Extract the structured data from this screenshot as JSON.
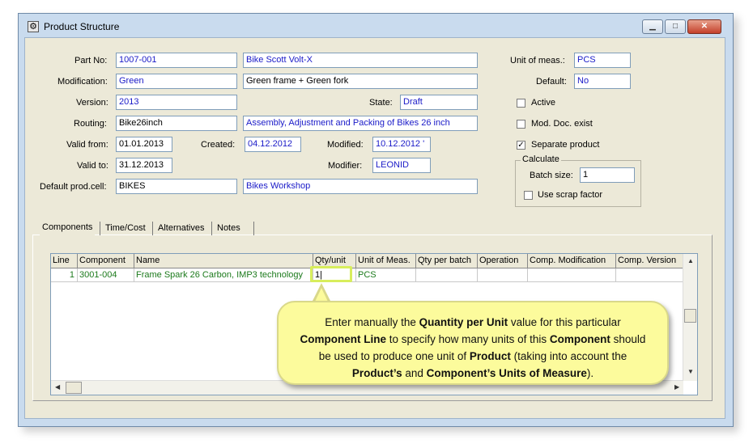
{
  "window": {
    "title": "Product Structure",
    "min_icon": "minimize-icon",
    "max_icon": "maximize-icon",
    "close_icon": "close-icon"
  },
  "form": {
    "part_no_label": "Part No:",
    "part_no": "1007-001",
    "part_name": "Bike Scott Volt-X",
    "modification_label": "Modification:",
    "modification": "Green",
    "modification_desc": "Green frame + Green fork",
    "version_label": "Version:",
    "version": "2013",
    "state_label": "State:",
    "state": "Draft",
    "routing_label": "Routing:",
    "routing": "Bike26inch",
    "routing_desc": "Assembly, Adjustment and Packing of Bikes 26 inch",
    "valid_from_label": "Valid from:",
    "valid_from": "01.01.2013",
    "created_label": "Created:",
    "created": "04.12.2012",
    "modified_label": "Modified:",
    "modified": "10.12.2012 '",
    "valid_to_label": "Valid to:",
    "valid_to": "31.12.2013",
    "modifier_label": "Modifier:",
    "modifier": "LEONID",
    "prod_cell_label": "Default prod.cell:",
    "prod_cell": "BIKES",
    "prod_cell_desc": "Bikes Workshop",
    "uom_label": "Unit of meas.:",
    "uom": "PCS",
    "default_label": "Default:",
    "default": "No",
    "active_label": "Active",
    "mod_doc_label": "Mod. Doc. exist",
    "separate_label": "Separate product",
    "calculate_label": "Calculate",
    "batch_label": "Batch size:",
    "batch": "1",
    "scrap_label": "Use scrap factor"
  },
  "tabs": [
    "Components",
    "Time/Cost",
    "Alternatives",
    "Notes"
  ],
  "grid": {
    "headers": [
      "Line",
      "Component",
      "Name",
      "Qty/unit",
      "Unit of Meas.",
      "Qty per batch",
      "Operation",
      "Comp. Modification",
      "Comp. Version"
    ],
    "rows": [
      [
        "1",
        "3001-004",
        "Frame Spark 26 Carbon, IMP3 technology",
        "1|",
        "PCS",
        "",
        "",
        "",
        ""
      ]
    ]
  },
  "callout": {
    "p1": "Enter manually the ",
    "b1": "Quantity per Unit",
    "p2": " value for this particular ",
    "b2": "Component  Line",
    "p3": " to specify how many units of this ",
    "b3": "Component",
    "p4": " should be used to produce one unit of ",
    "b4": "Product",
    "p5": " (taking into account the ",
    "b5": "Product’s",
    "p6": " and ",
    "b6": "Component’s Units of Measure",
    "p7": ")."
  }
}
